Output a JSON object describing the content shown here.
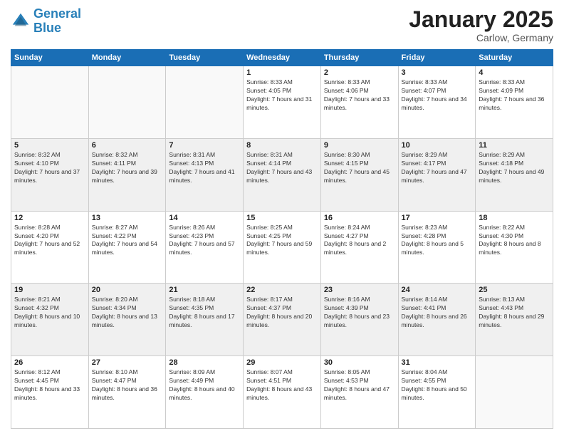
{
  "logo": {
    "line1": "General",
    "line2": "Blue"
  },
  "title": "January 2025",
  "location": "Carlow, Germany",
  "days_header": [
    "Sunday",
    "Monday",
    "Tuesday",
    "Wednesday",
    "Thursday",
    "Friday",
    "Saturday"
  ],
  "weeks": [
    [
      {
        "day": "",
        "sunrise": "",
        "sunset": "",
        "daylight": ""
      },
      {
        "day": "",
        "sunrise": "",
        "sunset": "",
        "daylight": ""
      },
      {
        "day": "",
        "sunrise": "",
        "sunset": "",
        "daylight": ""
      },
      {
        "day": "1",
        "sunrise": "Sunrise: 8:33 AM",
        "sunset": "Sunset: 4:05 PM",
        "daylight": "Daylight: 7 hours and 31 minutes."
      },
      {
        "day": "2",
        "sunrise": "Sunrise: 8:33 AM",
        "sunset": "Sunset: 4:06 PM",
        "daylight": "Daylight: 7 hours and 33 minutes."
      },
      {
        "day": "3",
        "sunrise": "Sunrise: 8:33 AM",
        "sunset": "Sunset: 4:07 PM",
        "daylight": "Daylight: 7 hours and 34 minutes."
      },
      {
        "day": "4",
        "sunrise": "Sunrise: 8:33 AM",
        "sunset": "Sunset: 4:09 PM",
        "daylight": "Daylight: 7 hours and 36 minutes."
      }
    ],
    [
      {
        "day": "5",
        "sunrise": "Sunrise: 8:32 AM",
        "sunset": "Sunset: 4:10 PM",
        "daylight": "Daylight: 7 hours and 37 minutes."
      },
      {
        "day": "6",
        "sunrise": "Sunrise: 8:32 AM",
        "sunset": "Sunset: 4:11 PM",
        "daylight": "Daylight: 7 hours and 39 minutes."
      },
      {
        "day": "7",
        "sunrise": "Sunrise: 8:31 AM",
        "sunset": "Sunset: 4:13 PM",
        "daylight": "Daylight: 7 hours and 41 minutes."
      },
      {
        "day": "8",
        "sunrise": "Sunrise: 8:31 AM",
        "sunset": "Sunset: 4:14 PM",
        "daylight": "Daylight: 7 hours and 43 minutes."
      },
      {
        "day": "9",
        "sunrise": "Sunrise: 8:30 AM",
        "sunset": "Sunset: 4:15 PM",
        "daylight": "Daylight: 7 hours and 45 minutes."
      },
      {
        "day": "10",
        "sunrise": "Sunrise: 8:29 AM",
        "sunset": "Sunset: 4:17 PM",
        "daylight": "Daylight: 7 hours and 47 minutes."
      },
      {
        "day": "11",
        "sunrise": "Sunrise: 8:29 AM",
        "sunset": "Sunset: 4:18 PM",
        "daylight": "Daylight: 7 hours and 49 minutes."
      }
    ],
    [
      {
        "day": "12",
        "sunrise": "Sunrise: 8:28 AM",
        "sunset": "Sunset: 4:20 PM",
        "daylight": "Daylight: 7 hours and 52 minutes."
      },
      {
        "day": "13",
        "sunrise": "Sunrise: 8:27 AM",
        "sunset": "Sunset: 4:22 PM",
        "daylight": "Daylight: 7 hours and 54 minutes."
      },
      {
        "day": "14",
        "sunrise": "Sunrise: 8:26 AM",
        "sunset": "Sunset: 4:23 PM",
        "daylight": "Daylight: 7 hours and 57 minutes."
      },
      {
        "day": "15",
        "sunrise": "Sunrise: 8:25 AM",
        "sunset": "Sunset: 4:25 PM",
        "daylight": "Daylight: 7 hours and 59 minutes."
      },
      {
        "day": "16",
        "sunrise": "Sunrise: 8:24 AM",
        "sunset": "Sunset: 4:27 PM",
        "daylight": "Daylight: 8 hours and 2 minutes."
      },
      {
        "day": "17",
        "sunrise": "Sunrise: 8:23 AM",
        "sunset": "Sunset: 4:28 PM",
        "daylight": "Daylight: 8 hours and 5 minutes."
      },
      {
        "day": "18",
        "sunrise": "Sunrise: 8:22 AM",
        "sunset": "Sunset: 4:30 PM",
        "daylight": "Daylight: 8 hours and 8 minutes."
      }
    ],
    [
      {
        "day": "19",
        "sunrise": "Sunrise: 8:21 AM",
        "sunset": "Sunset: 4:32 PM",
        "daylight": "Daylight: 8 hours and 10 minutes."
      },
      {
        "day": "20",
        "sunrise": "Sunrise: 8:20 AM",
        "sunset": "Sunset: 4:34 PM",
        "daylight": "Daylight: 8 hours and 13 minutes."
      },
      {
        "day": "21",
        "sunrise": "Sunrise: 8:18 AM",
        "sunset": "Sunset: 4:35 PM",
        "daylight": "Daylight: 8 hours and 17 minutes."
      },
      {
        "day": "22",
        "sunrise": "Sunrise: 8:17 AM",
        "sunset": "Sunset: 4:37 PM",
        "daylight": "Daylight: 8 hours and 20 minutes."
      },
      {
        "day": "23",
        "sunrise": "Sunrise: 8:16 AM",
        "sunset": "Sunset: 4:39 PM",
        "daylight": "Daylight: 8 hours and 23 minutes."
      },
      {
        "day": "24",
        "sunrise": "Sunrise: 8:14 AM",
        "sunset": "Sunset: 4:41 PM",
        "daylight": "Daylight: 8 hours and 26 minutes."
      },
      {
        "day": "25",
        "sunrise": "Sunrise: 8:13 AM",
        "sunset": "Sunset: 4:43 PM",
        "daylight": "Daylight: 8 hours and 29 minutes."
      }
    ],
    [
      {
        "day": "26",
        "sunrise": "Sunrise: 8:12 AM",
        "sunset": "Sunset: 4:45 PM",
        "daylight": "Daylight: 8 hours and 33 minutes."
      },
      {
        "day": "27",
        "sunrise": "Sunrise: 8:10 AM",
        "sunset": "Sunset: 4:47 PM",
        "daylight": "Daylight: 8 hours and 36 minutes."
      },
      {
        "day": "28",
        "sunrise": "Sunrise: 8:09 AM",
        "sunset": "Sunset: 4:49 PM",
        "daylight": "Daylight: 8 hours and 40 minutes."
      },
      {
        "day": "29",
        "sunrise": "Sunrise: 8:07 AM",
        "sunset": "Sunset: 4:51 PM",
        "daylight": "Daylight: 8 hours and 43 minutes."
      },
      {
        "day": "30",
        "sunrise": "Sunrise: 8:05 AM",
        "sunset": "Sunset: 4:53 PM",
        "daylight": "Daylight: 8 hours and 47 minutes."
      },
      {
        "day": "31",
        "sunrise": "Sunrise: 8:04 AM",
        "sunset": "Sunset: 4:55 PM",
        "daylight": "Daylight: 8 hours and 50 minutes."
      },
      {
        "day": "",
        "sunrise": "",
        "sunset": "",
        "daylight": ""
      }
    ]
  ]
}
